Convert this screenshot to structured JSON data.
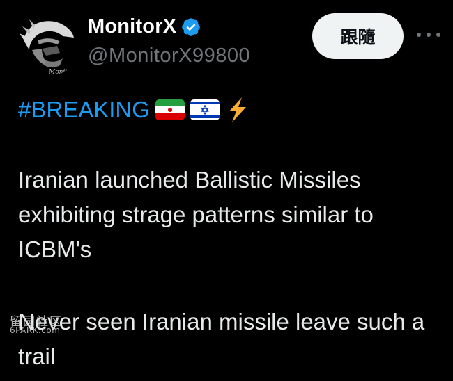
{
  "author": {
    "display_name": "MonitorX",
    "handle": "@MonitorX99800",
    "verified": true
  },
  "actions": {
    "follow_label": "跟隨",
    "more_icon": "more-horizontal-icon"
  },
  "post": {
    "hashtag": "#BREAKING",
    "emojis": [
      "iran-flag-icon",
      "israel-flag-icon",
      "lightning-bolt-icon"
    ],
    "paragraph1": "Iranian launched Ballistic Missiles exhibiting strage patterns similar to ICBM's",
    "paragraph2": "Never seen Iranian missile leave such a trail"
  },
  "watermark": {
    "cn": "留园社区",
    "en": "6PARK.com"
  },
  "colors": {
    "background": "#000000",
    "text": "#e7e9ea",
    "secondary": "#71767b",
    "accent": "#1d9bf0",
    "follow_button_bg": "#eff3f4"
  }
}
